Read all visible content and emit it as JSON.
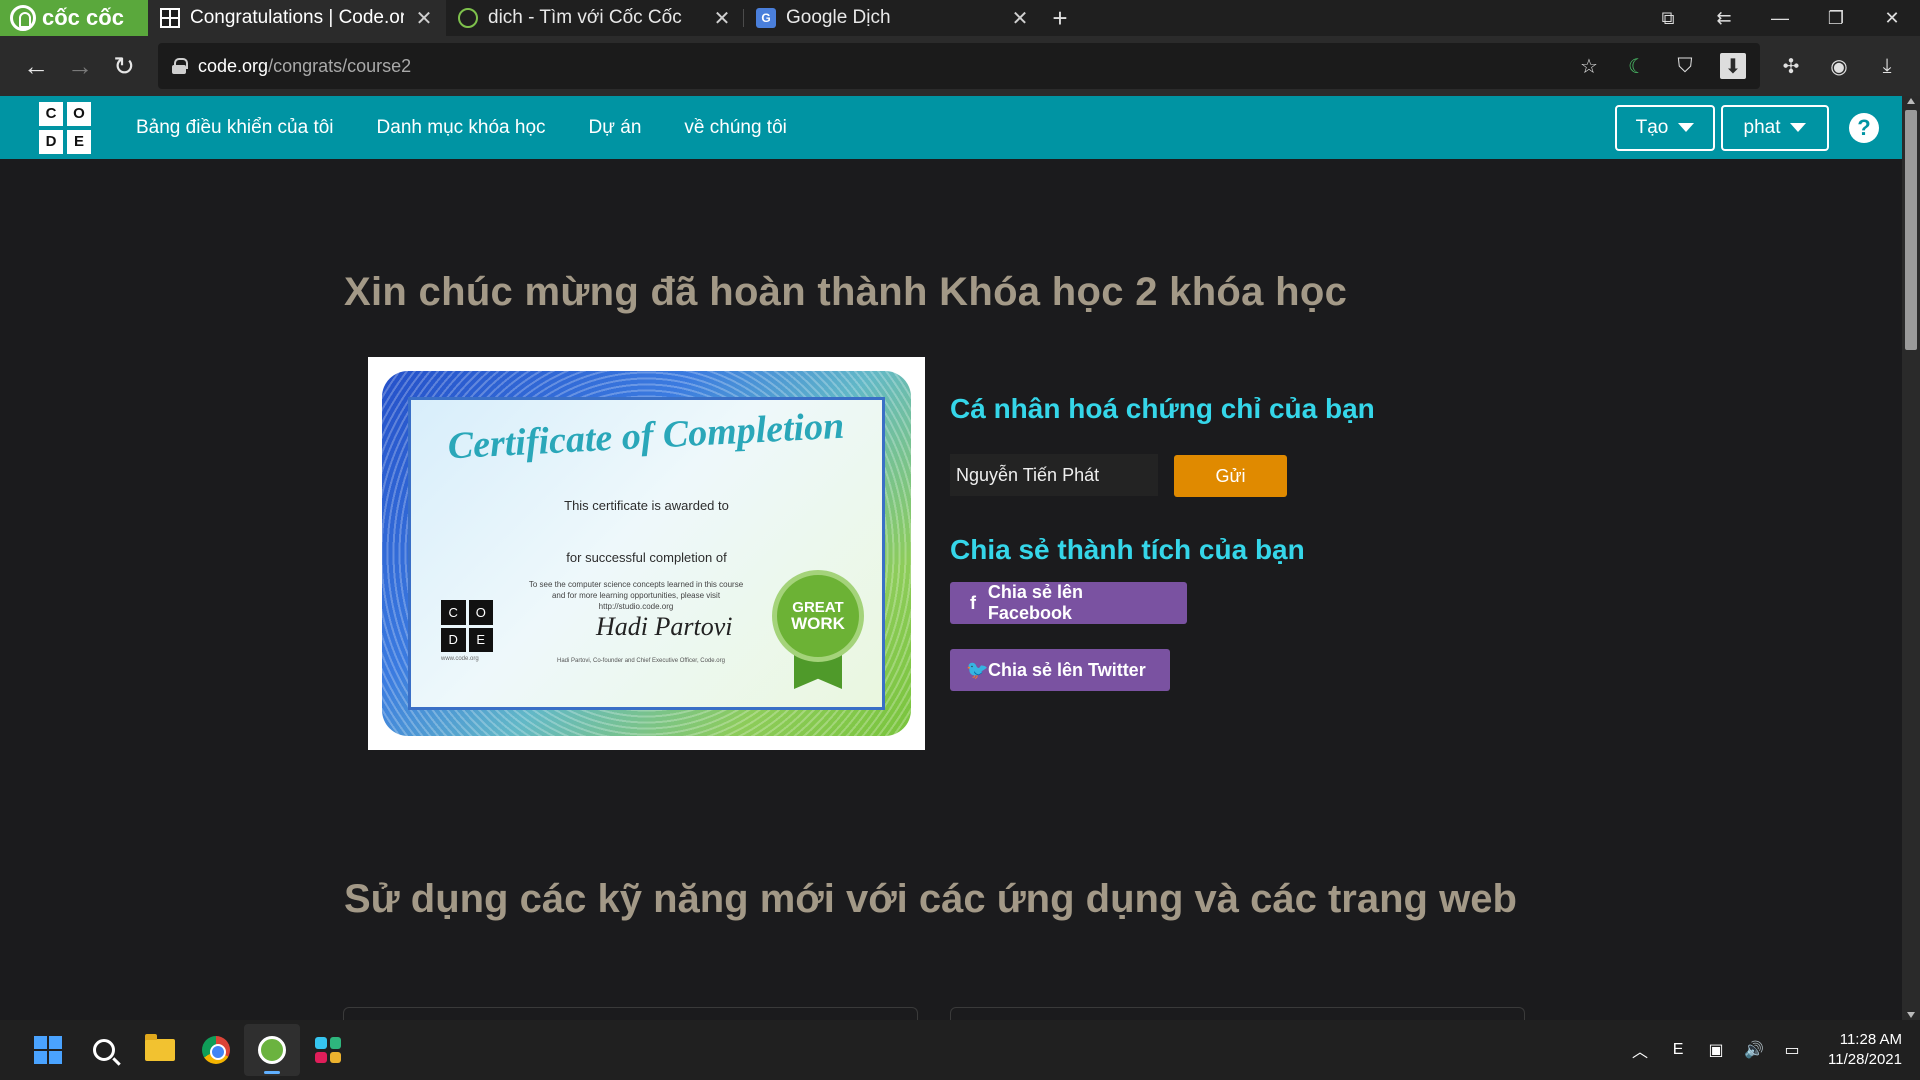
{
  "browser": {
    "brand_label": "cốc cốc",
    "tabs": [
      {
        "label": "Congratulations | Code.org",
        "active": true,
        "icon": "code-org-favicon"
      },
      {
        "label": "dich - Tìm với Cốc Cốc",
        "active": false,
        "icon": "coccoc-favicon"
      },
      {
        "label": "Google Dịch",
        "active": false,
        "icon": "google-translate-favicon"
      }
    ],
    "url_host": "code.org",
    "url_path": "/congrats/course2",
    "colors": {
      "brand": "#5aa83c",
      "tabstrip": "#1f1f1f",
      "addressbar": "#2b2b2b"
    }
  },
  "site": {
    "logo_letters": [
      "C",
      "O",
      "D",
      "E"
    ],
    "nav": [
      "Bảng điều khiển của tôi",
      "Danh mục khóa học",
      "Dự án",
      "về chúng tôi"
    ],
    "create_label": "Tạo",
    "user_label": "phat",
    "help_glyph": "?",
    "colors": {
      "header": "#0094a3"
    }
  },
  "main": {
    "title": "Xin chúc mừng đã hoàn thành Khóa học 2 khóa học",
    "certificate": {
      "heading": "Certificate of Completion",
      "awarded": "This certificate is awarded to",
      "completion": "for successful completion of",
      "note_line1": "To see the computer science concepts learned in this course",
      "note_line2": "and for more learning opportunities, please visit",
      "note_line3": "http://studio.code.org",
      "signer": "Hadi Partovi, Co-founder and Chief Executive Officer, Code.org",
      "signature": "Hadi Partovi",
      "badge_top": "GREAT",
      "badge_bottom": "WORK",
      "logo_letters": [
        "C",
        "O",
        "D",
        "E"
      ],
      "logo_url": "www.code.org"
    },
    "personalize_heading": "Cá nhân hoá chứng chỉ của bạn",
    "name_value": "Nguyễn Tiến Phát",
    "send_label": "Gửi",
    "share_heading": "Chia sẻ thành tích của bạn",
    "facebook_label": "Chia sẻ lên Facebook",
    "twitter_label": "Chia sẻ lên Twitter",
    "section2_title": "Sử dụng các kỹ năng mới với các ứng dụng và các trang web",
    "colors": {
      "title": "#a39987",
      "accent": "#35d6e9",
      "send": "#e08a00",
      "share": "#7a52a1"
    }
  },
  "taskbar": {
    "time": "11:28 AM",
    "date": "11/28/2021"
  }
}
